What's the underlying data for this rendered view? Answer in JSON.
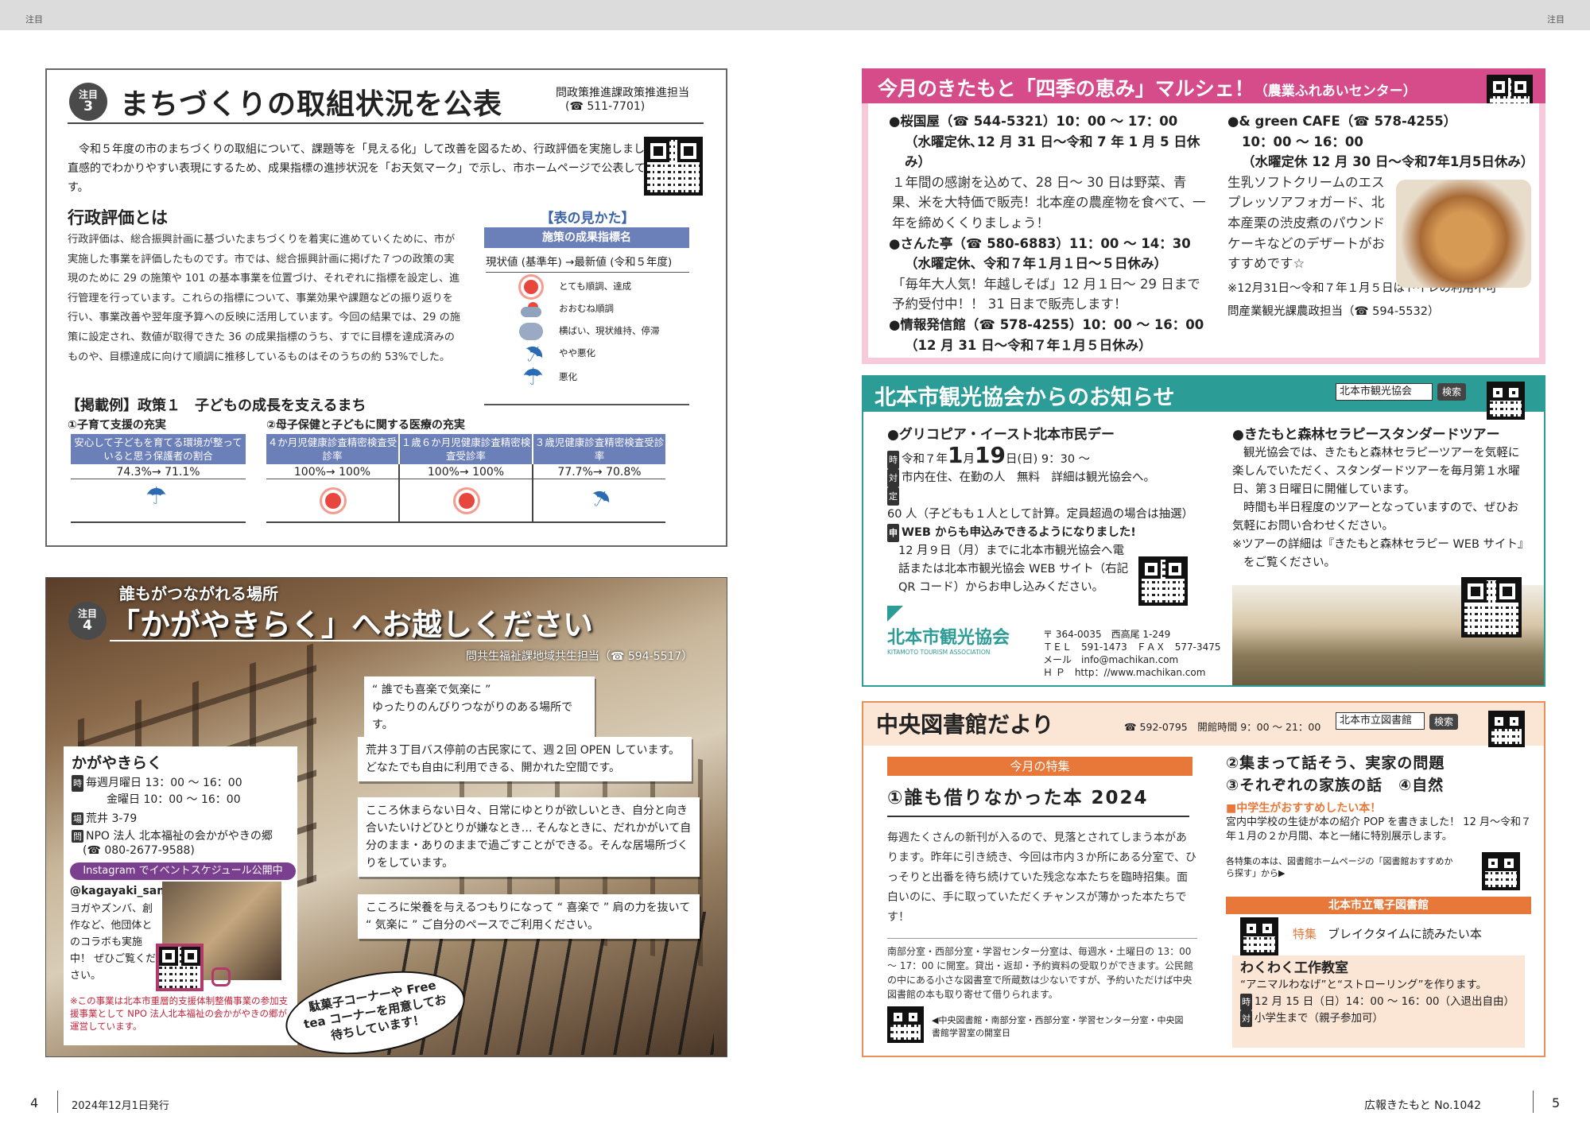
{
  "header": {
    "left": "注目",
    "right": "注目"
  },
  "s3": {
    "badge_a": "注目",
    "badge_b": "3",
    "title": "まちづくりの取組状況を公表",
    "contact_a": "問政策推進課政策推進担当",
    "contact_b": "(☎ 511-7701)",
    "intro": "令和５年度の市のまちづくりの取組について、課題等を「見える化」して改善を図るため、行政評価を実施しました。直感的でわかりやすい表現にするため、成果指標の進捗状況を「お天気マーク」で示し、市ホームページで公表しています。",
    "sub": "行政評価とは",
    "body": "行政評価は、総合振興計画に基づいたまちづくりを着実に進めていくために、市が実施した事業を評価したものです。市では、総合振興計画に掲げた７つの政策の実現のために 29 の施策や 101 の基本事業を位置づけ、それぞれに指標を設定し、進行管理を行っています。これらの指標について、事業効果や課題などの振り返りを行い、事業改善や翌年度予算への反映に活用しています。今回の結果では、29 の施策に設定され、数値が取得できた 36 の成果指標のうち、すでに目標を達成済みのものや、目標達成に向けて順調に推移しているものはそのうちの約 53%でした。",
    "legend": {
      "title": "【表の見かた】",
      "head": "施策の成果指標名",
      "sub": "現状値 (基準年) →最新値 (令和５年度)",
      "items": [
        "とても順調、達成",
        "おおむね順調",
        "横ばい、現状維持、停滞",
        "やや悪化",
        "悪化"
      ]
    },
    "example": "【掲載例】政策１　子どもの成長を支えるまち",
    "g1": "①子育て支援の充実",
    "g2": "②母子保健と子どもに関する医療の充実",
    "cols": [
      {
        "h": "安心して子どもを育てる環境が整っていると思う保護者の割合",
        "v": "74.3%→ 71.1%",
        "icon": "rain-umbrella-icon"
      },
      {
        "h": "４か月児健康診査精密検査受診率",
        "v": "100%→ 100%",
        "icon": "sun-icon"
      },
      {
        "h": "１歳６か月児健康診査精密検査受診率",
        "v": "100%→ 100%",
        "icon": "sun-icon"
      },
      {
        "h": "３歳児健康診査精密検査受診率",
        "v": "77.7%→ 70.8%",
        "icon": "folded-umbrella-icon"
      }
    ]
  },
  "s4": {
    "badge_a": "注目",
    "badge_b": "4",
    "pre": "誰もがつながれる場所",
    "title": "「かがやきらく」へお越しください",
    "contact": "問共生福祉課地域共生担当（☎ 594-5517）",
    "q1a": "“ 誰でも喜楽で気楽に ”",
    "q1b": "ゆったりのんびりつながりのある場所です。",
    "q2": "荒井３丁目バス停前の古民家にて、週２回 OPEN しています。どなたでも自由に利用できる、開かれた空間です。",
    "q3": "こころ休まらない日々、日常にゆとりが欲しいとき、自分と向き合いたいけどひとりが嫌なとき… そんなときに、だれかがいて自分のまま・ありのままで過ごすことができる。そんな居場所づくりをしています。",
    "q4": "こころに栄養を与えるつもりになって “ 喜楽で ” 肩の力を抜いて “ 気楽に ” ご自分のペースでご利用ください。",
    "info_title": "かがやきらく",
    "time1": "毎週月曜日 13：00 ～ 16：00",
    "time2": "金曜日 10：00 ～ 16：00",
    "place": "荒井 3-79",
    "org": "NPO 法人 北本福祉の会かがやきの郷",
    "tel": "(☎ 080-2677-9588)",
    "insta": "Instagram でイベントスケジュール公開中",
    "handle": "@kagayaki_sanka",
    "insta_text": "ヨガやズンバ、創作など、他団体とのコラボも実施中！ ぜひご覧ください。",
    "note": "※この事業は北本市重層的支援体制整備事業の参加支援事業として NPO 法人北本福祉の会かがやきの郷が運営しています。",
    "bubble": "駄菓子コーナーや Free tea コーナーを用意してお待ちしています！"
  },
  "marche": {
    "title": "今月のきたもと「四季の恵み」マルシェ！",
    "sub": "（農業ふれあいセンター）",
    "l1": "●桜国屋（☎ 544-5321）10：00 ～ 17：00",
    "l2": "（水曜定休､12 月 31 日～令和 7 年 1 月 5 日休み）",
    "l3": "１年間の感謝を込めて、28 日～ 30 日は野菜、青果、米を大特価で販売！北本産の農産物を食べて、一年を締めくくりましょう！",
    "l4": "●さんた亭（☎ 580-6883）11：00 ～ 14：30",
    "l5": "（水曜定休、令和７年１月１日～５日休み）",
    "l6": "「毎年大人気！年越しそば」12 月１日～ 29 日まで予約受付中！！ 31 日まで販売します！",
    "l7": "●情報発信館（☎ 578-4255）10：00 ～ 16：00",
    "l8": "（12 月 31 日～令和７年１月５日休み）",
    "r1": "●& green CAFE（☎ 578-4255）",
    "r2": "10：00 ～ 16：00",
    "r3": "（水曜定休 12 月 30 日～令和7年1月5日休み）",
    "r4": "生乳ソフトクリームのエスプレッソアフォガード、北本産栗の渋皮煮のパウンドケーキなどのデザートがおすすめです☆",
    "r5": "※12月31日～令和７年１月５日はトイレの利用不可",
    "r6": "問産業観光課農政担当（☎ 594-5532）"
  },
  "kanko": {
    "title": "北本市観光協会からのお知らせ",
    "search": "北本市観光協会",
    "search_btn": "検索",
    "e1": "●グリコピア・イースト北本市民デー",
    "e2a": "令和７年",
    "e2b": "1",
    "e2c": "月",
    "e2d": "19",
    "e2e": "日(日) 9：30 ～",
    "e3": "市内在住、在勤の人　無料　詳細は観光協会へ。",
    "e4": "60 人（子どもも１人として計算。定員超過の場合は抽選）",
    "e5": "WEB からも申込みできるようになりました!",
    "e6": "12 月９日（月）までに北本市観光協会へ電話または北本市観光協会 WEB サイト（右記 QR コード）からお申し込みください。",
    "logo": "北本市観光協会",
    "logo_en": "KITAMOTO TOURISM ASSOCIATION",
    "addr": "〒 364-0035　西高尾 1-249",
    "tel": "ＴＥＬ　591-1473　ＦＡＸ　577-3475",
    "mail": "メール　info@machikan.com",
    "hp": "Ｈ Ｐ　http：//www.machikan.com",
    "t1": "●きたもと森林セラピースタンダードツアー",
    "t2": "観光協会では、きたもと森林セラピーツアーを気軽に楽しんでいただく、スタンダードツアーを毎月第１水曜日、第３日曜日に開催しています。",
    "t3": "時間も半日程度のツアーとなっていますので、ぜひお気軽にお問い合わせください。",
    "t4": "※ツアーの詳細は『きたもと森林セラピー WEB サイト』をご覧ください。"
  },
  "lib": {
    "title": "中央図書館だより",
    "hours": "☎ 592-0795　開館時間 9：00 ～ 21：00",
    "search": "北本市立図書館",
    "search_btn": "検索",
    "feature_label": "今月の特集",
    "f1": "①誰も借りなかった本 2024",
    "f2": "②集まって話そう、実家の問題",
    "f3": "③それぞれの家族の話　④自然",
    "p1": "毎週たくさんの新刊が入るので、見落とされてしまう本があります。昨年に引き続き、今回は市内３か所にある分室で、ひっそりと出番を待ち続けていた残念な本たちを臨時招集。面白いのに、手に取っていただくチャンスが薄かった本たちです！",
    "p2": "南部分室・西部分室・学習センター分室は、毎週水・土曜日の 13：00 ～ 17：00 に開室。貸出・返却・予約資料の受取りができます。公民館の中にある小さな図書室で所蔵数は少ないですが、予約いただけば中央図書館の本も取り寄せて借りられます。",
    "p3": "◀中央図書館・南部分室・西部分室・学習センター分室・中央図書館学習室の開室日",
    "jh": "■中学生がおすすめしたい本！",
    "jh_t": "宮内中学校の生徒が本の紹介 POP を書きました！ 12 月～令和７年１月の２か月間、本と一緒に特別展示します。",
    "jh_n": "各特集の本は、図書館ホームページの「図書館おすすめから探す」から▶",
    "ebook": "北本市立電子図書館",
    "ebook_t1": "特集",
    "ebook_t2": "ブレイクタイムに読みたい本",
    "w1": "わくわく工作教室",
    "w2": "“アニマルわなげ”と“ストローリング”を作ります。",
    "w3": "12 月 15 日（日）14：00 ～ 16：00（入退出自由）",
    "w4": "小学生まで（親子参加可）"
  },
  "footer": {
    "pl": "4",
    "dl": "2024年12月1日発行",
    "dr": "広報きたもと No.1042",
    "pr": "5"
  }
}
